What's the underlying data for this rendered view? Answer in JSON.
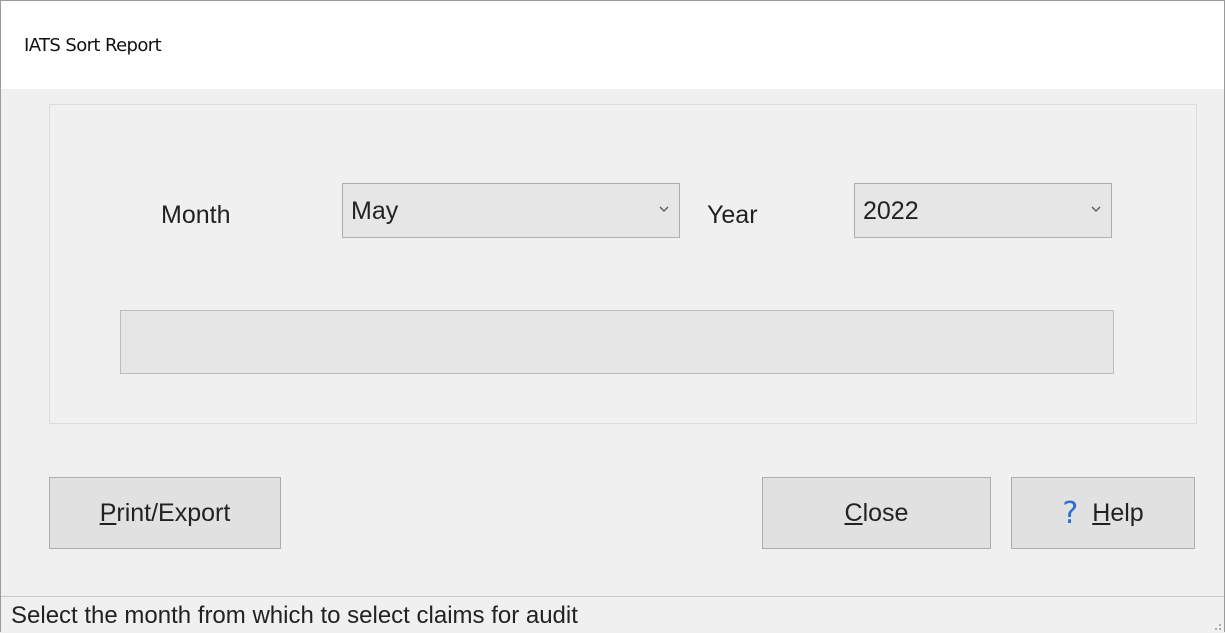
{
  "window": {
    "title": "IATS Sort Report"
  },
  "form": {
    "month_label": "Month",
    "month_value": "May",
    "year_label": "Year",
    "year_value": "2022",
    "progress": 0
  },
  "buttons": {
    "print_export": {
      "mnemonic": "P",
      "rest": "rint/Export"
    },
    "close": {
      "mnemonic": "C",
      "rest": "lose"
    },
    "help": {
      "icon": "question-mark-icon",
      "mnemonic": "H",
      "rest": "elp"
    }
  },
  "status_bar": {
    "text": "Select the month from which to select claims for audit"
  }
}
